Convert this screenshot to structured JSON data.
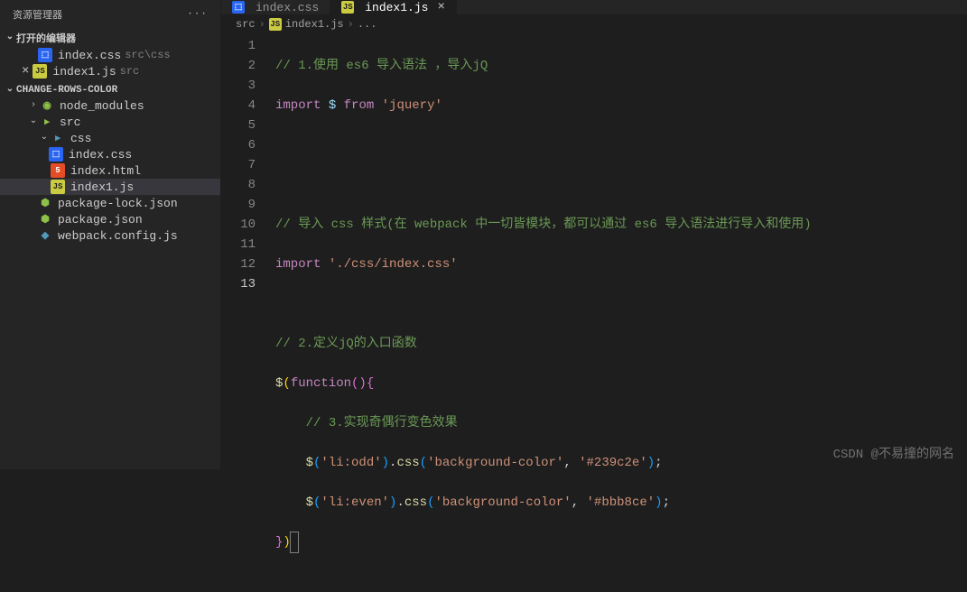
{
  "sidebar": {
    "title": "资源管理器",
    "open_editors_label": "打开的编辑器",
    "open_editors": [
      {
        "name": "index.css",
        "sub": "src\\css",
        "icon": "css"
      },
      {
        "name": "index1.js",
        "sub": "src",
        "icon": "js",
        "close": true
      }
    ],
    "project_name": "CHANGE-ROWS-COLOR",
    "tree": {
      "node_modules": "node_modules",
      "src": "src",
      "css": "css",
      "index_css": "index.css",
      "index_html": "index.html",
      "index1_js": "index1.js",
      "pkg_lock": "package-lock.json",
      "pkg": "package.json",
      "webpack": "webpack.config.js"
    }
  },
  "tabs": {
    "t1": "index.css",
    "t2": "index1.js"
  },
  "breadcrumb": {
    "b1": "src",
    "b2": "index1.js",
    "b3": "..."
  },
  "code": {
    "lines": [
      "1",
      "2",
      "3",
      "4",
      "5",
      "6",
      "7",
      "8",
      "9",
      "10",
      "11",
      "12",
      "13"
    ],
    "l1_cmt": "// 1.使用 es6 导入语法 ，导入jQ",
    "l2_import": "import",
    "l2_var": "$",
    "l2_from": "from",
    "l2_str": "'jquery'",
    "l5_cmt": "// 导入 css 样式(在 webpack 中一切皆模块，都可以通过 es6 导入语法进行导入和使用)",
    "l6_import": "import",
    "l6_str": "'./css/index.css'",
    "l8_cmt": "// 2.定义jQ的入口函数",
    "l9_dollar": "$",
    "l9_func": "function",
    "l10_cmt": "// 3.实现奇偶行变色效果",
    "l11_dollar": "$",
    "l11_sel": "'li:odd'",
    "l11_css": "css",
    "l11_prop": "'background-color'",
    "l11_val": "'#239c2e'",
    "l12_dollar": "$",
    "l12_sel": "'li:even'",
    "l12_css": "css",
    "l12_prop": "'background-color'",
    "l12_val": "'#bbb8ce'"
  },
  "watermark": "CSDN @不易撞的网名"
}
